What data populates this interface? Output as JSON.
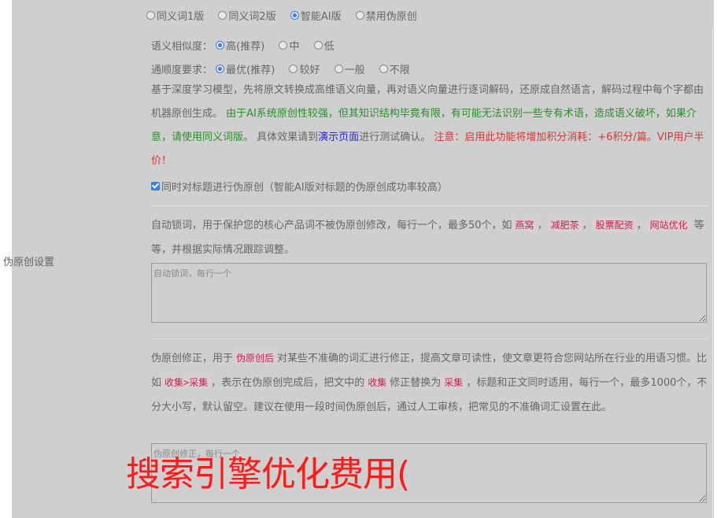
{
  "row_label": "伪原创设置",
  "version_options": [
    {
      "label": "同义词1版",
      "checked": false
    },
    {
      "label": "同义词2版",
      "checked": false
    },
    {
      "label": "智能AI版",
      "checked": true
    },
    {
      "label": "禁用伪原创",
      "checked": false
    }
  ],
  "similarity": {
    "label": "语义相似度：",
    "options": [
      {
        "label": "高(推荐)",
        "checked": true
      },
      {
        "label": "中",
        "checked": false
      },
      {
        "label": "低",
        "checked": false
      }
    ]
  },
  "fluency": {
    "label": "通顺度要求：",
    "options": [
      {
        "label": "最优(推荐)",
        "checked": true
      },
      {
        "label": "较好",
        "checked": false
      },
      {
        "label": "一般",
        "checked": false
      },
      {
        "label": "不限",
        "checked": false
      }
    ]
  },
  "description": {
    "part1": "基于深度学习模型，先将原文转换成高维语义向量，再对语义向量进行逐词解码，还原成自然语言，解码过程中每个字都由机器原创生成。",
    "part2_green": "由于AI系统原创性较强，但其知识结构毕竟有限，有可能无法识别一些专有术语，造成语义破坏，如果介意，请使用同义词版。",
    "part3": "具体效果请到",
    "link": "演示页面",
    "part4": "进行测试确认。",
    "part5_red": "注意：启用此功能将增加积分消耗：+6积分/篇。VIP用户半价！"
  },
  "title_checkbox": {
    "label": "同时对标题进行伪原创（智能AI版对标题的伪原创成功率较高）",
    "checked": true
  },
  "lock_words": {
    "text1": "自动锁词，用于保护您的核心产品词不被伪原创修改，每行一个，最多50个，如",
    "examples": [
      "燕窝",
      "减肥茶",
      "股票配资",
      "网站优化"
    ],
    "sep": "，",
    "text2": "等等，并根据实际情况跟踪调整。",
    "placeholder": "自动锁词，每行一个"
  },
  "correction": {
    "text1": "伪原创修正，用于",
    "tag1": "伪原创后",
    "text2": "对某些不准确的词汇进行修正，提高文章可读性，使文章更符合您网站所在行业的用语习惯。比如",
    "tag2": "收集>采集",
    "text3": "，表示在伪原创完成后，把文中的",
    "tag3": "收集",
    "text4": "修正替换为",
    "tag4": "采集",
    "text5": "，标题和正文同时适用，每行一个，最多1000个，不分大小写，默认留空。建议在使用一段时间伪原创后，通过人工审核，把常见的不准确词汇设置在此。",
    "placeholder": "伪原创修正，每行一个"
  },
  "overlay_text": "搜索引擎优化费用(",
  "colors": {
    "panel_bg": "#cfcfcf",
    "accent": "#3b7de0",
    "green": "#2e8b2e",
    "red": "#d23a3a",
    "link": "#2a2ad4",
    "tag": "#c7254e",
    "overlay": "#ff1a1a"
  }
}
